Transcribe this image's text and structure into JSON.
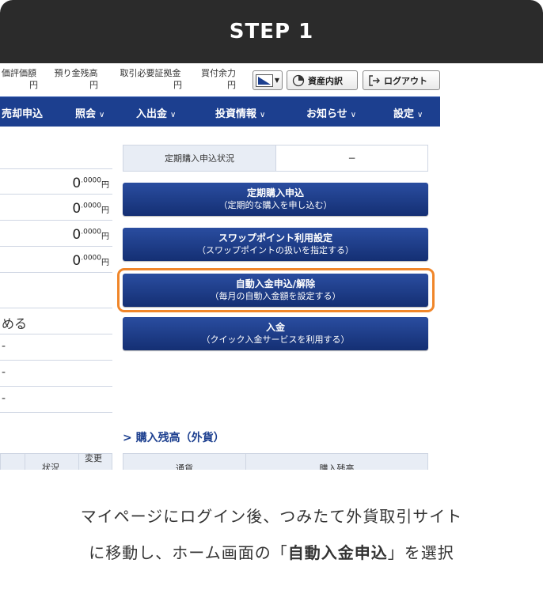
{
  "header": {
    "step": "STEP 1"
  },
  "infobar": {
    "cols": [
      {
        "label": "価評価額",
        "unit": "円"
      },
      {
        "label": "預り金残高",
        "unit": "円"
      },
      {
        "label": "取引必要証拠金",
        "unit": "円"
      },
      {
        "label": "買付余力",
        "unit": "円"
      }
    ],
    "asset_button": "資産内訳",
    "logout_button": "ログアウト"
  },
  "nav": {
    "items": [
      {
        "label": "売却申込",
        "has_chevron": false
      },
      {
        "label": "照会",
        "has_chevron": true
      },
      {
        "label": "入出金",
        "has_chevron": true
      },
      {
        "label": "投資情報",
        "has_chevron": true
      },
      {
        "label": "お知らせ",
        "has_chevron": true
      },
      {
        "label": "設定",
        "has_chevron": true
      }
    ]
  },
  "left_table": {
    "amounts": [
      {
        "int": "0",
        "dec": ".0000",
        "unit": "円"
      },
      {
        "int": "0",
        "dec": ".0000",
        "unit": "円"
      },
      {
        "int": "0",
        "dec": ".0000",
        "unit": "円"
      },
      {
        "int": "0",
        "dec": ".0000",
        "unit": "円"
      }
    ],
    "label_row": "める",
    "dash_rows": [
      "-",
      "-",
      "-"
    ],
    "lower_headers": [
      "状況",
      "変更"
    ]
  },
  "status": {
    "label": "定期購入申込状況",
    "value": "−"
  },
  "buttons": [
    {
      "title": "定期購入申込",
      "sub": "（定期的な購入を申し込む）"
    },
    {
      "title": "スワップポイント利用設定",
      "sub": "（スワップポイントの扱いを指定する）"
    },
    {
      "title": "自動入金申込/解除",
      "sub": "（毎月の自動入金額を設定する）"
    },
    {
      "title": "入金",
      "sub": "（クイック入金サービスを利用する）"
    }
  ],
  "section": {
    "title": "> 購入残高（外貨）",
    "headers": [
      "通貨",
      "購入残高"
    ]
  },
  "caption": {
    "line1": "マイページにログイン後、つみたて外貨取引サイト",
    "line2_pre": "に移動し、ホーム画面の「",
    "line2_bold": "自動入金申込",
    "line2_post": "」を選択"
  },
  "colors": {
    "accent": "#f0862a",
    "nav": "#1c3f8f",
    "header_bg": "#2b2b2b"
  }
}
